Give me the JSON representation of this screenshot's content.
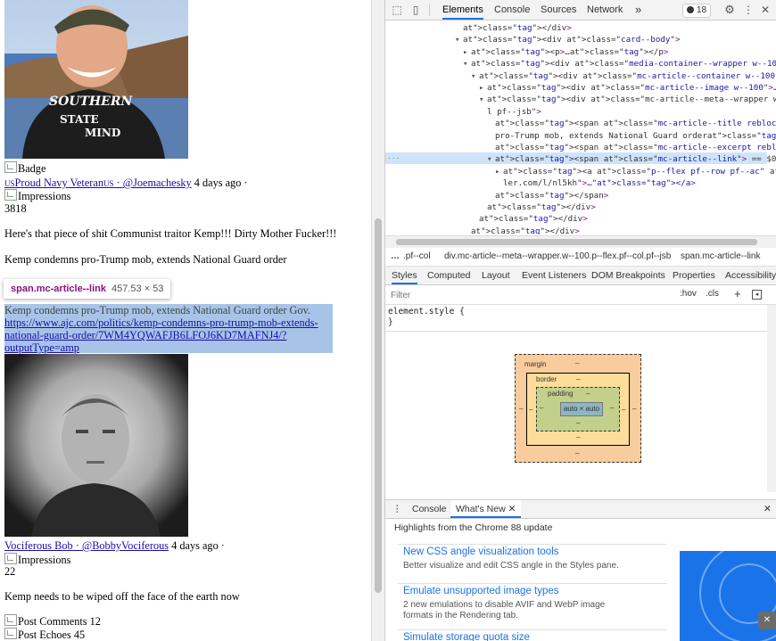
{
  "page": {
    "badge_alt": "Badge",
    "post1": {
      "author_prefix_flag": "US",
      "author_name": "Proud Navy Veteran",
      "author_suffix_flag": "US",
      "separator": " · ",
      "handle": "@Joemachesky",
      "time": " 4 days ago ·",
      "impressions_alt": "Impressions",
      "impressions_count": "3818",
      "body": "Here's that piece of shit Communist traitor Kemp!!! Dirty Mother Fucker!!!",
      "article_title": "Kemp condemns pro-Trump mob, extends National Guard order",
      "article_excerpt": "Kemp condemns pro-Trump mob, extends National Guard order Gov.",
      "article_link_line1": "https://www.ajc.com/politics/kemp-condemns-pro-trump-mob-extends-",
      "article_link_line2": "national-guard-order/7WM4YQWAFJB6LFOJ6KD7MAFNJ4/?",
      "article_link_line3": "outputType=amp"
    },
    "tooltip": {
      "selector_tag": "span",
      "selector_class": ".mc-article--link",
      "size": "457.53 × 53"
    },
    "post2": {
      "author_name": "Vociferous Bob",
      "separator": " · ",
      "handle": "@BobbyVociferous",
      "time": " 4 days ago ·",
      "impressions_alt": "Impressions",
      "impressions_count": "22",
      "body": "Kemp needs to be wiped off the face of the earth now",
      "comments_alt": "Post Comments",
      "comments_count": " 12",
      "echoes_alt": "Post Echoes",
      "echoes_count": " 45"
    }
  },
  "devtools": {
    "tabs": [
      "Elements",
      "Console",
      "Sources",
      "Network"
    ],
    "more_tabs": "»",
    "error_count": "18",
    "tree": [
      {
        "indent": 0,
        "tri": "",
        "html": "</div>"
      },
      {
        "indent": 0,
        "tri": "▾",
        "html": "<div class=\"card--body\">"
      },
      {
        "indent": 1,
        "tri": "▸",
        "html": "<p>…</p>"
      },
      {
        "indent": 1,
        "tri": "▾",
        "html": "<div class=\"media-container--wrapper w--100\">"
      },
      {
        "indent": 2,
        "tri": "▾",
        "html": "<div class=\"mc-article--container w--100 p--flex pf--col\">"
      },
      {
        "indent": 3,
        "tri": "▸",
        "html": "<div class=\"mc-article--image w--100\">…</div>"
      },
      {
        "indent": 3,
        "tri": "▾",
        "html": "<div class=\"mc-article--meta--wrapper w--100 p--flex pf--co"
      },
      {
        "indent": 3,
        "tri": "",
        "html": "l pf--jsb\">"
      },
      {
        "indent": 4,
        "tri": "",
        "html": "<span class=\"mc-article--title reblock\">Kemp condemns"
      },
      {
        "indent": 4,
        "tri": "",
        "html": "pro-Trump mob, extends National Guard order</span>"
      },
      {
        "indent": 4,
        "tri": "",
        "html": "<span class=\"mc-article--excerpt reblock\">Gov.</span>"
      },
      {
        "indent": 4,
        "tri": "▾",
        "html": "<span class=\"mc-article--link\"> == $0"
      },
      {
        "indent": 5,
        "tri": "▸",
        "html": "<a class=\"p--flex pf--row pf--ac\" href=\"https://api.par"
      },
      {
        "indent": 5,
        "tri": "",
        "html": "ler.com/l/nl5kh\">…</a>"
      },
      {
        "indent": 4,
        "tri": "",
        "html": "</span>"
      },
      {
        "indent": 3,
        "tri": "",
        "html": "</div>"
      },
      {
        "indent": 2,
        "tri": "",
        "html": "</div>"
      },
      {
        "indent": 1,
        "tri": "",
        "html": "</div>"
      }
    ],
    "breadcrumbs": [
      "…",
      ".pf--col",
      "div.mc-article--meta--wrapper.w--100.p--flex.pf--col.pf--jsb",
      "span.mc-article--link"
    ],
    "style_tabs": [
      "Styles",
      "Computed",
      "Layout",
      "Event Listeners",
      "DOM Breakpoints",
      "Properties",
      "Accessibility"
    ],
    "filter_placeholder": "Filter",
    "filter_hov": ":hov",
    "filter_cls": ".cls",
    "filter_plus": "+",
    "element_style_open": "element.style {",
    "element_style_close": "}",
    "boxmodel": {
      "margin": "margin",
      "border": "border",
      "padding": "padding",
      "content": "auto × auto",
      "dash": "–"
    },
    "drawer_tabs": [
      "Console",
      "What's New"
    ],
    "highlights": "Highlights from the Chrome 88 update",
    "whatsnew": [
      {
        "title": "New CSS angle visualization tools",
        "desc": "Better visualize and edit CSS angle in the Styles pane."
      },
      {
        "title": "Emulate unsupported image types",
        "desc": "2 new emulations to disable AVIF and WebP image formats in the Rendering tab."
      },
      {
        "title": "Simulate storage quota size",
        "desc": ""
      }
    ],
    "colors": {
      "accent": "#1a73e8",
      "selection": "#a7c4e8"
    }
  }
}
